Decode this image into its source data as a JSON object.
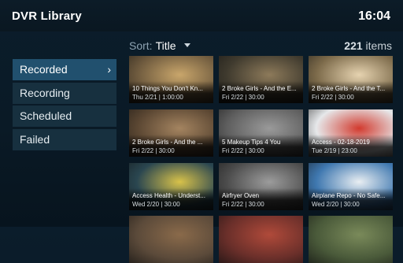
{
  "header": {
    "title": "DVR Library",
    "clock": "16:04"
  },
  "toolbar": {
    "sort_label": "Sort:",
    "sort_value": "Title",
    "count_number": "221",
    "count_label": "items"
  },
  "sidebar": {
    "items": [
      {
        "label": "Recorded",
        "active": true
      },
      {
        "label": "Recording",
        "active": false
      },
      {
        "label": "Scheduled",
        "active": false
      },
      {
        "label": "Failed",
        "active": false
      }
    ]
  },
  "grid": {
    "tiles": [
      {
        "title": "10 Things You Don't Kn...",
        "meta": "Thu 2/21 | 1:00:00",
        "bg": "#6e5a3e",
        "accent": "#c9a66b"
      },
      {
        "title": "2 Broke Girls - And the E...",
        "meta": "Fri 2/22 | 30:00",
        "bg": "#3f3a2e",
        "accent": "#8d7a5a"
      },
      {
        "title": "2 Broke Girls - And the T...",
        "meta": "Fri 2/22 | 30:00",
        "bg": "#7c6a4a",
        "accent": "#e6d3b0"
      },
      {
        "title": "2 Broke Girls - And the ...",
        "meta": "Fri 2/22 | 30:00",
        "bg": "#5a4632",
        "accent": "#a48460"
      },
      {
        "title": "5 Makeup Tips 4 You",
        "meta": "Fri 2/22 | 30:00",
        "bg": "#5e5e5e",
        "accent": "#9a9a9a"
      },
      {
        "title": "Access - 02-18-2019",
        "meta": "Tue 2/19 | 23:00",
        "bg": "#e6e8ea",
        "accent": "#d23a2e"
      },
      {
        "title": "Access Health - Underst...",
        "meta": "Wed 2/20 | 30:00",
        "bg": "#2a4650",
        "accent": "#d8c24a"
      },
      {
        "title": "Airfryer Oven",
        "meta": "Fri 2/22 | 30:00",
        "bg": "#4c4c4c",
        "accent": "#9c9c9c"
      },
      {
        "title": "Airplane Repo - No Safe...",
        "meta": "Wed 2/20 | 30:00",
        "bg": "#3f78b0",
        "accent": "#e9eef2"
      },
      {
        "title": "",
        "meta": "",
        "bg": "#5b4a3a",
        "accent": "#8a6a4a"
      },
      {
        "title": "",
        "meta": "",
        "bg": "#6a2f2a",
        "accent": "#b04a3a"
      },
      {
        "title": "",
        "meta": "",
        "bg": "#4a5a3a",
        "accent": "#7a8a5a"
      }
    ]
  }
}
